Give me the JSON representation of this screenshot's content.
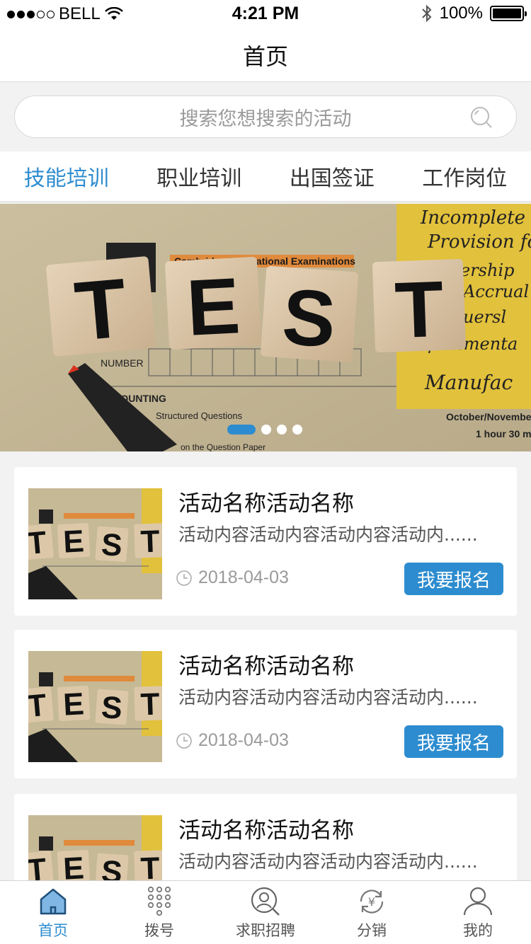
{
  "status": {
    "carrier": "BELL",
    "time": "4:21 PM",
    "battery": "100%",
    "battery_level": 1.0
  },
  "nav": {
    "title": "首页"
  },
  "search": {
    "placeholder": "搜索您想搜索的活动"
  },
  "tabs": [
    {
      "label": "技能培训",
      "active": true
    },
    {
      "label": "职业培训",
      "active": false
    },
    {
      "label": "出国签证",
      "active": false
    },
    {
      "label": "工作岗位",
      "active": false
    }
  ],
  "banner": {
    "tiles": [
      "T",
      "E",
      "S",
      "T"
    ],
    "paper_header": "Cambridge International Examinations",
    "paper_lines": [
      "NUMBER",
      "ACCOUNTING",
      "Structured Questions",
      "on the Question Paper"
    ],
    "note_lines": [
      "Incomplete",
      "Provision fo",
      "ership",
      "Accrual",
      "uersl",
      "partmenta",
      "Manufac"
    ],
    "paper_right": [
      "October/November",
      "1 hour 30 m"
    ],
    "page_count": 4,
    "active_page": 1
  },
  "cards": [
    {
      "title": "活动名称活动名称",
      "desc": "活动内容活动内容活动内容活动内......",
      "date": "2018-04-03",
      "button": "我要报名"
    },
    {
      "title": "活动名称活动名称",
      "desc": "活动内容活动内容活动内容活动内......",
      "date": "2018-04-03",
      "button": "我要报名"
    },
    {
      "title": "活动名称活动名称",
      "desc": "活动内容活动内容活动内容活动内......",
      "date": "",
      "button": ""
    }
  ],
  "tabbar": [
    {
      "label": "首页",
      "icon": "home-icon",
      "active": true
    },
    {
      "label": "拨号",
      "icon": "dialpad-icon",
      "active": false
    },
    {
      "label": "求职招聘",
      "icon": "job-search-icon",
      "active": false
    },
    {
      "label": "分销",
      "icon": "distribution-icon",
      "active": false
    },
    {
      "label": "我的",
      "icon": "profile-icon",
      "active": false
    }
  ],
  "colors": {
    "accent": "#2d8ccf",
    "background": "#f2f2f2"
  }
}
